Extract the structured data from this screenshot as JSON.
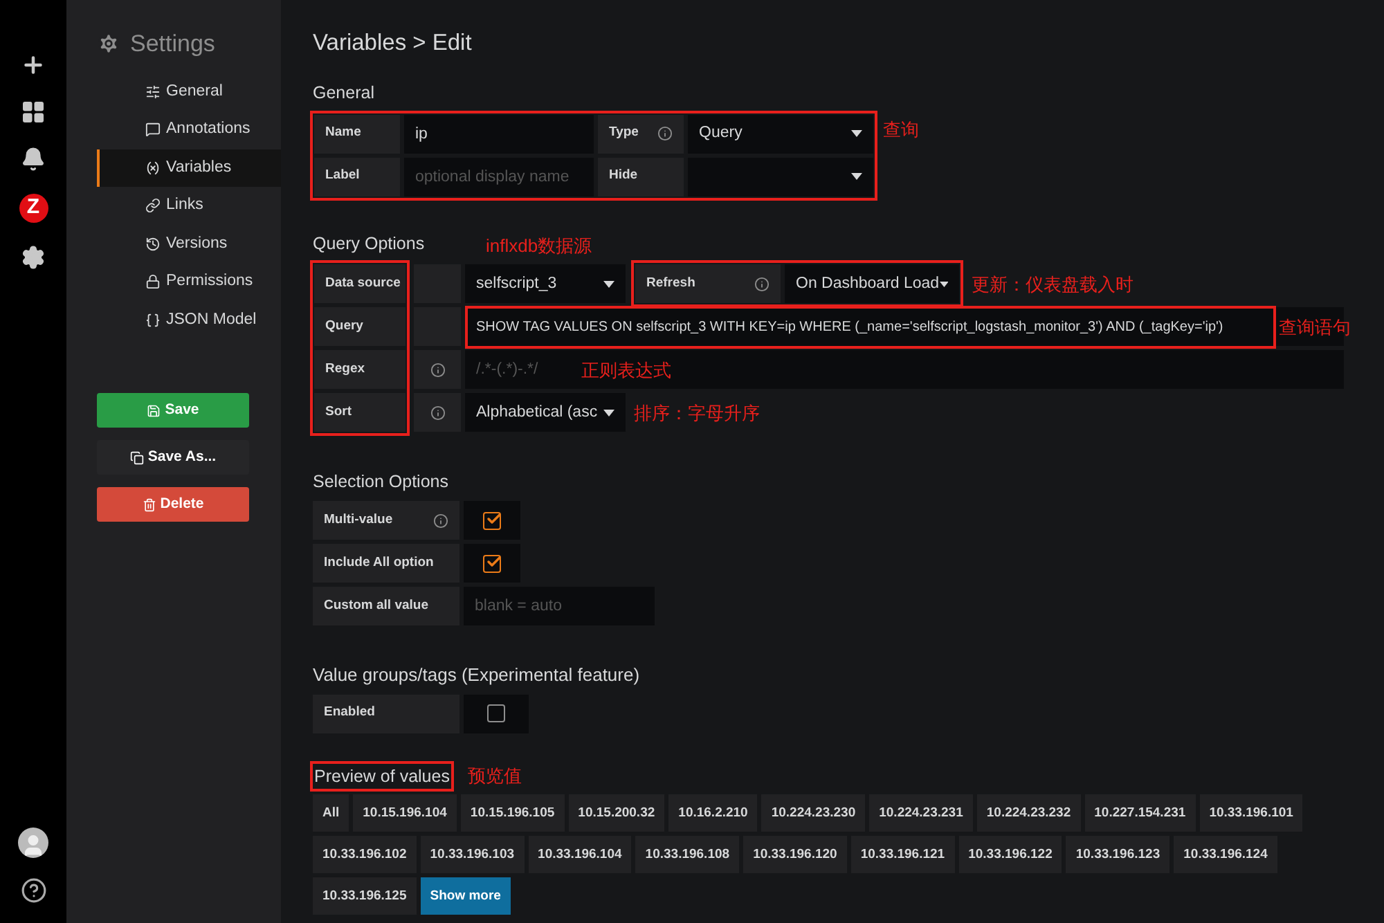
{
  "rail": {
    "logo_letter": "Z"
  },
  "sidebar": {
    "title": "Settings",
    "items": [
      {
        "label": "General",
        "selected": false
      },
      {
        "label": "Annotations",
        "selected": false
      },
      {
        "label": "Variables",
        "selected": true
      },
      {
        "label": "Links",
        "selected": false
      },
      {
        "label": "Versions",
        "selected": false
      },
      {
        "label": "Permissions",
        "selected": false
      },
      {
        "label": "JSON Model",
        "selected": false
      }
    ],
    "buttons": [
      {
        "label": "Save",
        "kind": "primary"
      },
      {
        "label": "Save As...",
        "kind": "secondary"
      },
      {
        "label": "Delete",
        "kind": "danger"
      }
    ]
  },
  "title": "Variables > Edit",
  "general": {
    "heading": "General",
    "annotation": "查询",
    "name": {
      "label": "Name",
      "value": "ip"
    },
    "type": {
      "label": "Type",
      "value": "Query"
    },
    "label_field": {
      "label": "Label",
      "placeholder": "optional display name"
    },
    "hide": {
      "label": "Hide"
    }
  },
  "query_options": {
    "heading": "Query Options",
    "data_source": {
      "label": "Data source",
      "value": "selfscript_3",
      "annotation": "inflxdb数据源"
    },
    "refresh": {
      "label": "Refresh",
      "value": "On Dashboard Load",
      "annotation": "更新：仪表盘载入时"
    },
    "query": {
      "label": "Query",
      "value": "SHOW TAG VALUES ON selfscript_3 WITH KEY=ip WHERE (_name='selfscript_logstash_monitor_3') AND (_tagKey='ip')",
      "annotation": "查询语句"
    },
    "regex": {
      "label": "Regex",
      "placeholder": "/.*-(.*)-.*/",
      "annotation": "正则表达式"
    },
    "sort": {
      "label": "Sort",
      "value": "Alphabetical (asc",
      "annotation": "排序：字母升序"
    }
  },
  "selection_options": {
    "heading": "Selection Options",
    "multi_value": {
      "label": "Multi-value",
      "checked": true
    },
    "include_all": {
      "label": "Include All option",
      "checked": true
    },
    "custom_all": {
      "label": "Custom all value",
      "placeholder": "blank = auto"
    }
  },
  "value_groups": {
    "heading": "Value groups/tags (Experimental feature)",
    "enabled": {
      "label": "Enabled",
      "checked": false
    }
  },
  "preview": {
    "heading": "Preview of values",
    "annotation": "预览值",
    "values": [
      "All",
      "10.15.196.104",
      "10.15.196.105",
      "10.15.200.32",
      "10.16.2.210",
      "10.224.23.230",
      "10.224.23.231",
      "10.224.23.232",
      "10.227.154.231",
      "10.33.196.101",
      "10.33.196.102",
      "10.33.196.103",
      "10.33.196.104",
      "10.33.196.108",
      "10.33.196.120",
      "10.33.196.121",
      "10.33.196.122",
      "10.33.196.123",
      "10.33.196.124",
      "10.33.196.125"
    ],
    "show_more": "Show more"
  }
}
